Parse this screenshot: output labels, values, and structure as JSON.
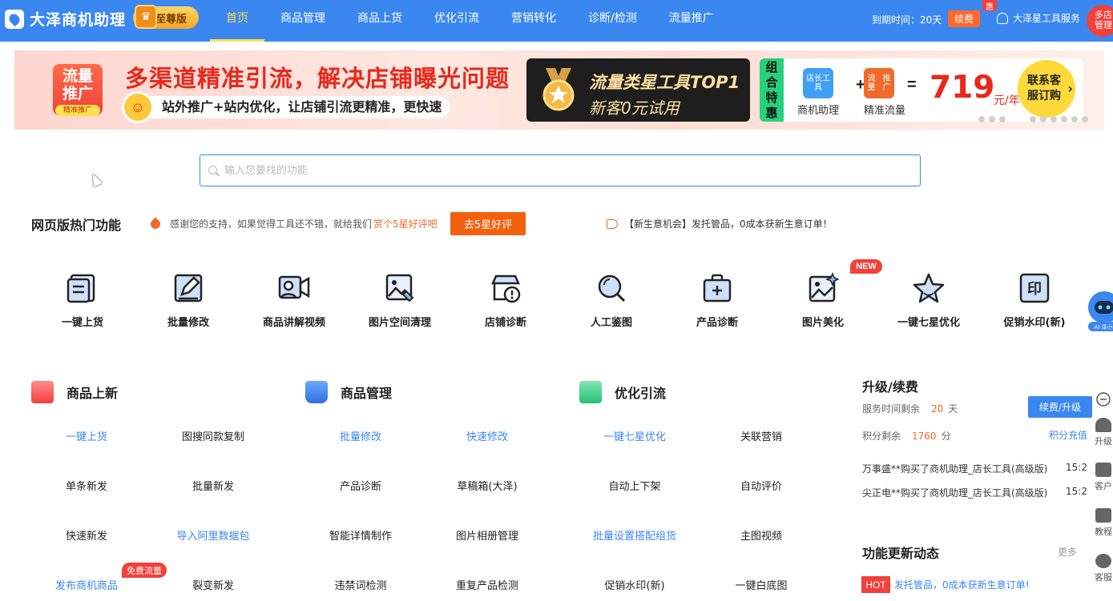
{
  "header": {
    "app_name": "大泽商机助理",
    "edition": "至尊版",
    "nav": [
      "首页",
      "商品管理",
      "商品上货",
      "优化引流",
      "营销转化",
      "诊断/检测",
      "流量推广"
    ],
    "expire_text": "到期时间：20天",
    "renew_label": "续费",
    "hui_badge": "惠",
    "account_name": "大泽星工具服务",
    "multi_store": [
      "多店",
      "管理"
    ]
  },
  "banner": {
    "badge_title": [
      "流量",
      "推广"
    ],
    "badge_sub": "精准推广",
    "headline": "多渠道精准引流，解决店铺曝光问题",
    "subline": "站外推广+站内优化，让店铺引流更精准，更快速",
    "dark_line1": "流量类星工具TOP1",
    "dark_line2": "新客0元试用",
    "combo_tag": [
      "组",
      "合",
      "特",
      "惠"
    ],
    "item1_pic": "店长工具",
    "item1_label": "商机助理",
    "item2_pic": [
      "流量",
      "推广"
    ],
    "item2_label": "精准流量",
    "plus": "+",
    "equals": "=",
    "price": "719",
    "price_unit": "元/年",
    "buy": [
      "联系客",
      "服订购"
    ]
  },
  "search": {
    "placeholder": "输入您要找的功能",
    "value": ""
  },
  "hot": {
    "title": "网页版热门功能",
    "thanks_text": "感谢您的支持，如果觉得工具还不错，就给我们",
    "thanks_em": "赏个5星好评吧",
    "rate_btn": "去5星好评",
    "notice": "【新生意机会】发托管品，0成本获新生意订单！",
    "new_badge": "NEW",
    "tools": [
      "一键上货",
      "批量修改",
      "商品讲解视频",
      "图片空间清理",
      "店铺诊断",
      "人工鉴图",
      "产品诊断",
      "图片美化",
      "一键七星优化",
      "促销水印(新)"
    ]
  },
  "categories": [
    {
      "title": "商品上新",
      "links": [
        "一键上货",
        "图搜同款复制",
        "单条新发",
        "批量新发",
        "快速新发",
        "导入阿里数据包",
        "发布商机商品",
        "裂变新发"
      ]
    },
    {
      "title": "商品管理",
      "links": [
        "批量修改",
        "快速修改",
        "产品诊断",
        "草稿箱(大泽)",
        "智能详情制作",
        "图片相册管理",
        "违禁词检测",
        "重复产品检测"
      ]
    },
    {
      "title": "优化引流",
      "links": [
        "一键七星优化",
        "关联营销",
        "自动上下架",
        "自动评价",
        "批量设置搭配组货",
        "主图视频",
        "促销水印(新)",
        "一键白底图"
      ]
    }
  ],
  "free_badge": "免费流量",
  "panel": {
    "title": "升级/续费",
    "service_label": "服务时间剩余",
    "service_value": "20",
    "service_unit": "天",
    "upgrade_btn": "续费/升级",
    "points_label": "积分剩余",
    "points_value": "1760",
    "points_unit": "分",
    "recharge": "积分充值",
    "feed": [
      {
        "text": "万事盛**购买了商机助理_店长工具(高级版)",
        "time": "15:2"
      },
      {
        "text": "尖正电**购买了商机助理_店长工具(高级版)",
        "time": "15:2"
      }
    ],
    "updates_title": "功能更新动态",
    "more": "更多",
    "hot_tag": "HOT",
    "update_link": "发托管品，0成本获新生意订单!"
  },
  "sidebar": {
    "ai_label": "AI·泽小",
    "items": [
      "升级",
      "客户",
      "教程",
      "客服"
    ]
  },
  "colors": {
    "primary": "#3a87f0",
    "accent": "#f5600f",
    "red": "#f0413a",
    "highlight": "#ffe04d"
  }
}
